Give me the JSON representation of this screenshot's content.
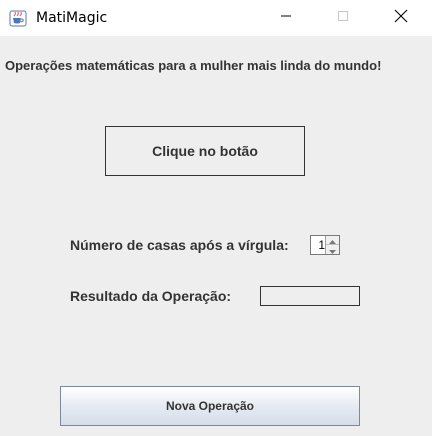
{
  "window": {
    "title": "MatiMagic",
    "icon": "java-coffee-cup-icon"
  },
  "titlebar_controls": {
    "minimize_icon": "minimize-icon",
    "maximize_icon": "maximize-icon",
    "close_icon": "close-icon"
  },
  "main": {
    "headline": "Operações matemáticas para a mulher mais linda do mundo!",
    "action_button_label": "Clique no botão",
    "decimals_label": "Número de casas após a vírgula:",
    "decimals_value": "1",
    "result_label": "Resultado da Operação:",
    "result_value": "",
    "new_operation_button_label": "Nova Operação"
  },
  "colors": {
    "content_background": "#eeeeee",
    "text": "#333333",
    "button_gradient_bottom": "#d4dde9"
  }
}
